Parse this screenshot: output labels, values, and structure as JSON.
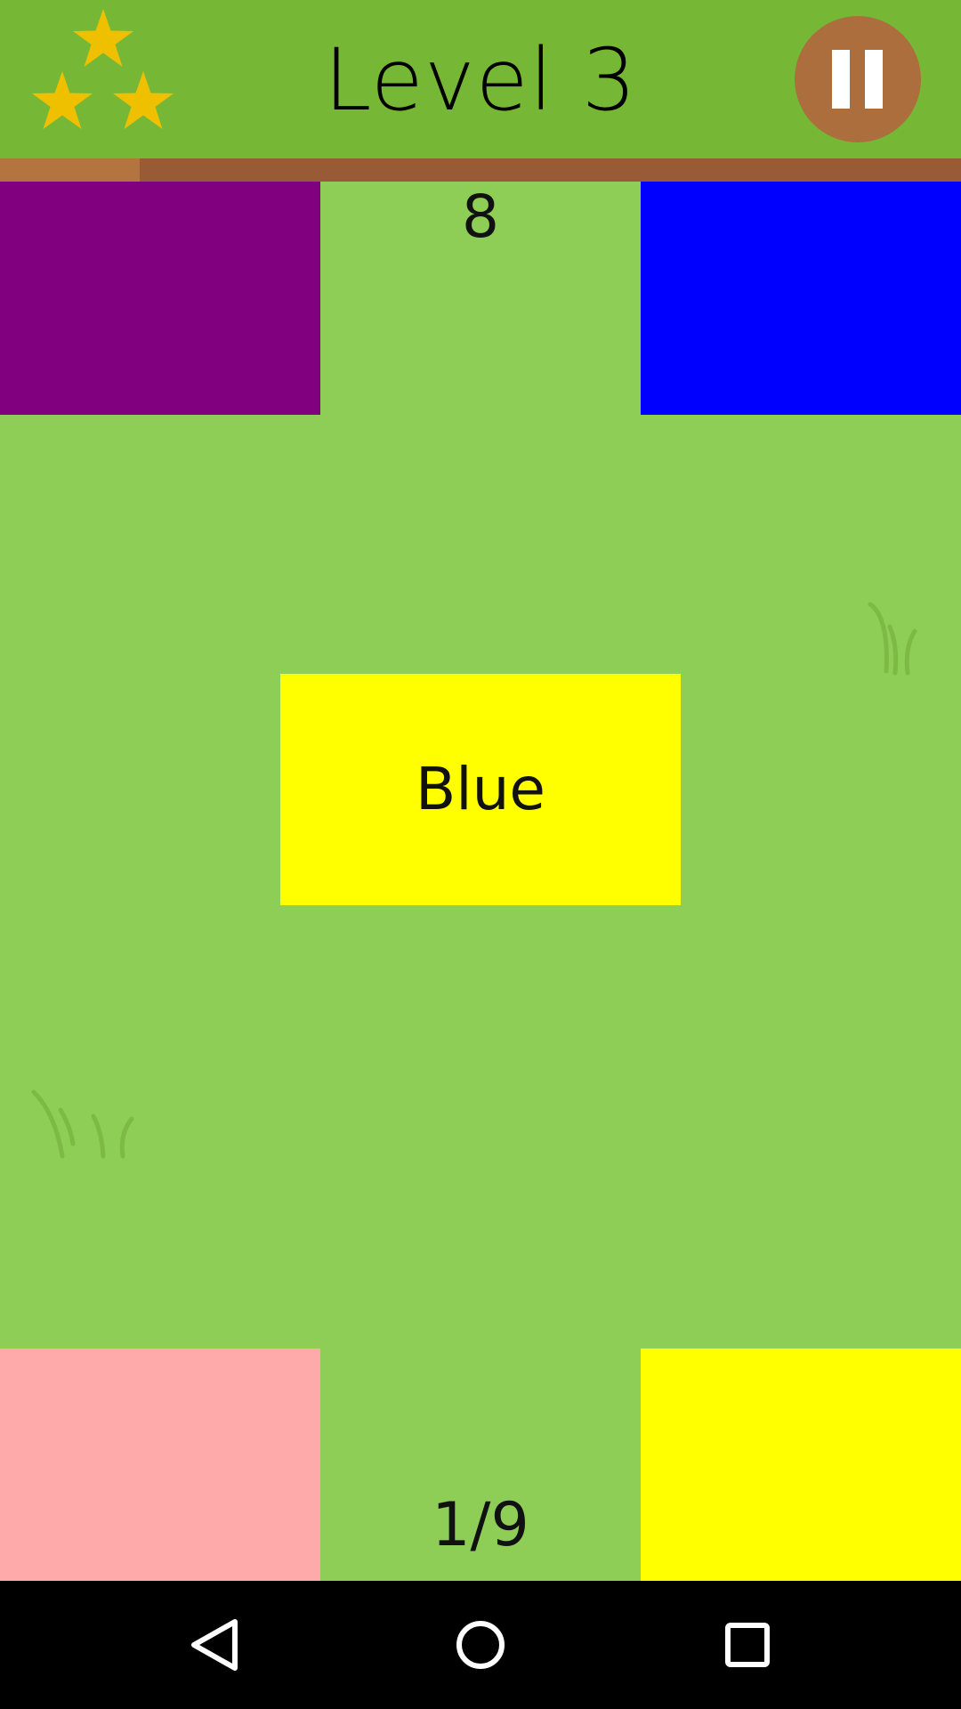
{
  "header": {
    "title": "Level 3",
    "stars_earned": 3,
    "stars_total": 3,
    "star_color": "#eec000",
    "background_color": "#76b836",
    "pause_button_color": "#ab6e3c",
    "pause_icon": "pause-icon"
  },
  "timer": {
    "remaining_fraction": 0.145,
    "track_color": "#995b35",
    "fill_color": "#b47440"
  },
  "board": {
    "background_color": "#8ecd56",
    "countdown": "8",
    "word": "Blue",
    "word_card_color": "#ffff00",
    "progress": "1/9",
    "tiles": [
      {
        "position": "top-left",
        "color": "#800080"
      },
      {
        "position": "top-right",
        "color": "#0000ff"
      },
      {
        "position": "bottom-left",
        "color": "#ffaaaa"
      },
      {
        "position": "bottom-right",
        "color": "#ffff00"
      }
    ]
  },
  "navbar": {
    "back_icon": "back-triangle-icon",
    "home_icon": "home-circle-icon",
    "recent_icon": "recents-square-icon"
  }
}
